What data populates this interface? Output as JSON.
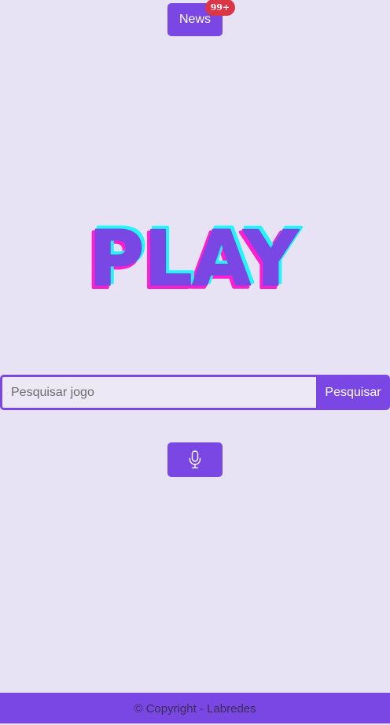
{
  "header": {
    "news_label": "News",
    "news_badge": "99+"
  },
  "logo": {
    "text": "PLAY",
    "fill_color": "#7b47e4",
    "shadow_colors": [
      "#ff1fd1",
      "#25f4ff"
    ]
  },
  "search": {
    "placeholder": "Pesquisar jogo",
    "value": "",
    "button_label": "Pesquisar"
  },
  "voice": {
    "icon": "microphone-icon"
  },
  "footer": {
    "text": "© Copyright - Labredes"
  },
  "colors": {
    "background": "#e8e3f4",
    "accent": "#7b47e4",
    "badge": "#dc3545"
  }
}
